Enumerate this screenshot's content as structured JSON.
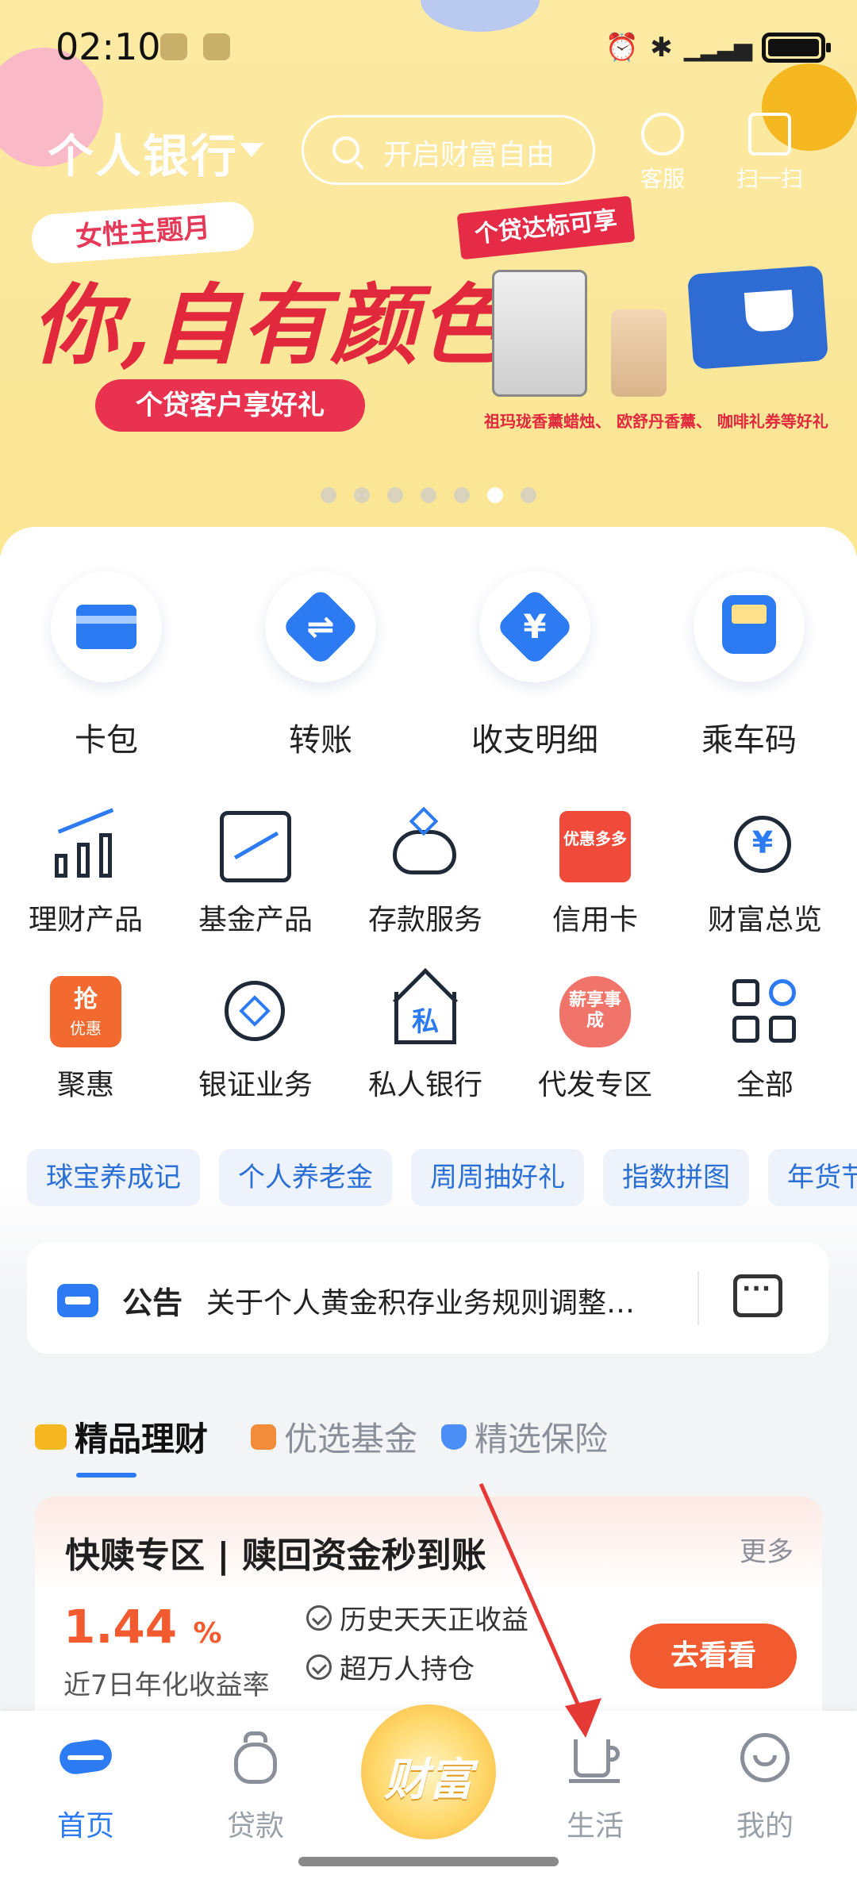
{
  "status_bar": {
    "time": "02:10"
  },
  "top_bar": {
    "title": "个人银行",
    "search_placeholder": "开启财富自由",
    "actions": [
      {
        "label": "客服",
        "icon": "headset-icon"
      },
      {
        "label": "扫一扫",
        "icon": "scan-icon"
      }
    ]
  },
  "banner": {
    "tag": "女性主题月",
    "headline": "你,自有颜色",
    "subtitle": "个贷客户享好礼",
    "badge": "个贷达标可享",
    "products_caption": "祖玛珑香薰蜡烛、 欧舒丹香薰、 咖啡礼券等好礼",
    "page_count": 7,
    "active_page": 6
  },
  "quick_actions": [
    {
      "label": "卡包",
      "icon": "card-wallet-icon"
    },
    {
      "label": "转账",
      "icon": "transfer-icon"
    },
    {
      "label": "收支明细",
      "icon": "yuan-statement-icon"
    },
    {
      "label": "乘车码",
      "icon": "bus-code-icon"
    }
  ],
  "services_row1": [
    {
      "label": "理财产品",
      "icon": "bar-chart-icon"
    },
    {
      "label": "基金产品",
      "icon": "trend-chart-icon"
    },
    {
      "label": "存款服务",
      "icon": "piggy-bank-icon"
    },
    {
      "label": "信用卡",
      "icon": "gift-card-icon",
      "badge": "优惠多多"
    },
    {
      "label": "财富总览",
      "icon": "wealth-search-icon"
    }
  ],
  "services_row2": [
    {
      "label": "聚惠",
      "icon": "deal-icon",
      "badge_top": "抢",
      "badge_bottom": "优惠"
    },
    {
      "label": "银证业务",
      "icon": "securities-icon"
    },
    {
      "label": "私人银行",
      "icon": "private-bank-icon",
      "glyph": "私"
    },
    {
      "label": "代发专区",
      "icon": "salary-icon",
      "badge": "薪享事成"
    },
    {
      "label": "全部",
      "icon": "grid-all-icon"
    }
  ],
  "chips": [
    "球宝养成记",
    "个人养老金",
    "周周抽好礼",
    "指数拼图",
    "年货节"
  ],
  "notice": {
    "title": "公告",
    "text": "关于个人黄金积存业务规则调整…"
  },
  "product_tabs": [
    {
      "label": "精品理财",
      "active": true
    },
    {
      "label": "优选基金",
      "active": false
    },
    {
      "label": "精选保险",
      "active": false
    }
  ],
  "featured_card": {
    "title": "快赎专区 | 赎回资金秒到账",
    "more": "更多",
    "rate": "1.44",
    "rate_unit": "%",
    "rate_label": "近7日年化收益率",
    "features": [
      "历史天天正收益",
      "超万人持仓"
    ],
    "button": "去看看"
  },
  "bottom_nav": [
    {
      "label": "首页",
      "active": true,
      "icon": "home-icon"
    },
    {
      "label": "贷款",
      "active": false,
      "icon": "money-bag-icon"
    },
    {
      "label": "财富",
      "active": false,
      "icon": "wealth-coins-icon"
    },
    {
      "label": "生活",
      "active": false,
      "icon": "coffee-cup-icon"
    },
    {
      "label": "我的",
      "active": false,
      "icon": "profile-icon"
    }
  ],
  "colors": {
    "primary": "#2d7bf3",
    "accent": "#f25a2f",
    "banner_bg": "#fbe79a",
    "banner_red": "#e1283d",
    "annotation_arrow": "#e53935"
  }
}
